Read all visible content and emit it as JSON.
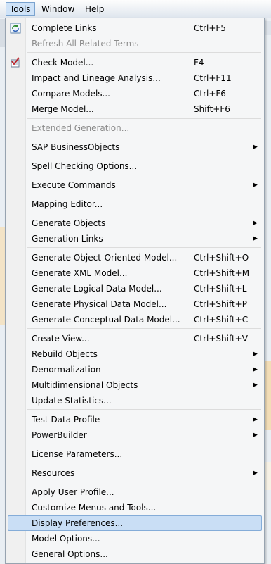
{
  "menubar": {
    "tools": "Tools",
    "window": "Window",
    "help": "Help"
  },
  "menu": {
    "complete_links": {
      "label": "Complete Links",
      "shortcut": "Ctrl+F5"
    },
    "refresh_terms": {
      "label": "Refresh All Related Terms"
    },
    "check_model": {
      "label": "Check Model...",
      "shortcut": "F4"
    },
    "impact_lineage": {
      "label": "Impact and Lineage Analysis...",
      "shortcut": "Ctrl+F11"
    },
    "compare_models": {
      "label": "Compare Models...",
      "shortcut": "Ctrl+F6"
    },
    "merge_model": {
      "label": "Merge Model...",
      "shortcut": "Shift+F6"
    },
    "extended_generation": {
      "label": "Extended Generation..."
    },
    "sap_businessobjects": {
      "label": "SAP BusinessObjects"
    },
    "spell_checking": {
      "label": "Spell Checking Options..."
    },
    "execute_commands": {
      "label": "Execute Commands"
    },
    "mapping_editor": {
      "label": "Mapping Editor..."
    },
    "generate_objects": {
      "label": "Generate Objects"
    },
    "generation_links": {
      "label": "Generation Links"
    },
    "gen_oo_model": {
      "label": "Generate Object-Oriented Model...",
      "shortcut": "Ctrl+Shift+O"
    },
    "gen_xml_model": {
      "label": "Generate XML Model...",
      "shortcut": "Ctrl+Shift+M"
    },
    "gen_logical": {
      "label": "Generate Logical Data Model...",
      "shortcut": "Ctrl+Shift+L"
    },
    "gen_physical": {
      "label": "Generate Physical Data Model...",
      "shortcut": "Ctrl+Shift+P"
    },
    "gen_conceptual": {
      "label": "Generate Conceptual Data Model...",
      "shortcut": "Ctrl+Shift+C"
    },
    "create_view": {
      "label": "Create View...",
      "shortcut": "Ctrl+Shift+V"
    },
    "rebuild_objects": {
      "label": "Rebuild Objects"
    },
    "denormalization": {
      "label": "Denormalization"
    },
    "multidimensional": {
      "label": "Multidimensional Objects"
    },
    "update_statistics": {
      "label": "Update Statistics..."
    },
    "test_data_profile": {
      "label": "Test Data Profile"
    },
    "powerbuilder": {
      "label": "PowerBuilder"
    },
    "license_parameters": {
      "label": "License Parameters..."
    },
    "resources": {
      "label": "Resources"
    },
    "apply_user_profile": {
      "label": "Apply User Profile..."
    },
    "customize_menus": {
      "label": "Customize Menus and Tools..."
    },
    "display_preferences": {
      "label": "Display Preferences..."
    },
    "model_options": {
      "label": "Model Options..."
    },
    "general_options": {
      "label": "General Options..."
    },
    "submenu_arrow": "▶"
  },
  "colors": {
    "highlight": "#c9def5",
    "highlight_border": "#84acd8",
    "disabled": "#8d8d8d"
  }
}
